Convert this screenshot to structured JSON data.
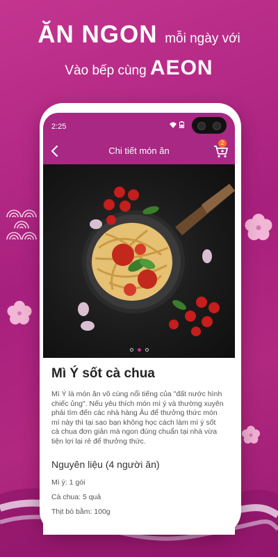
{
  "promo": {
    "line1_big": "ĂN NGON",
    "line1_small": "mỗi ngày với",
    "line2_small": "Vào bếp cùng",
    "line2_big": "AEON"
  },
  "status": {
    "time": "2:25"
  },
  "appbar": {
    "title": "Chi tiết món ăn",
    "cart_count": "2"
  },
  "carousel": {
    "count": 3,
    "active": 1
  },
  "recipe": {
    "title": "Mì Ý sốt cà chua",
    "description": "Mì Ý là món ăn vô cùng nổi tiếng của \"đất nước hình chiếc ủng\". Nếu yêu thích món mì ý và thường xuyên phải tìm đến các nhà hàng Âu để thưởng thức món mì này thì tại sao bạn không học cách làm mì ý sốt cà chua đơn giản mà ngon đúng chuẩn tại nhà vừa tiện lợi lại rẻ để thưởng thức.",
    "ingredients_heading": "Nguyên liệu (4 người ăn)",
    "ingredients": [
      "Mì ý: 1 gói",
      "Cà chua: 5 quả",
      "Thịt bò bằm: 100g"
    ]
  },
  "colors": {
    "brand": "#a82884",
    "accent": "#ff6a2a"
  }
}
